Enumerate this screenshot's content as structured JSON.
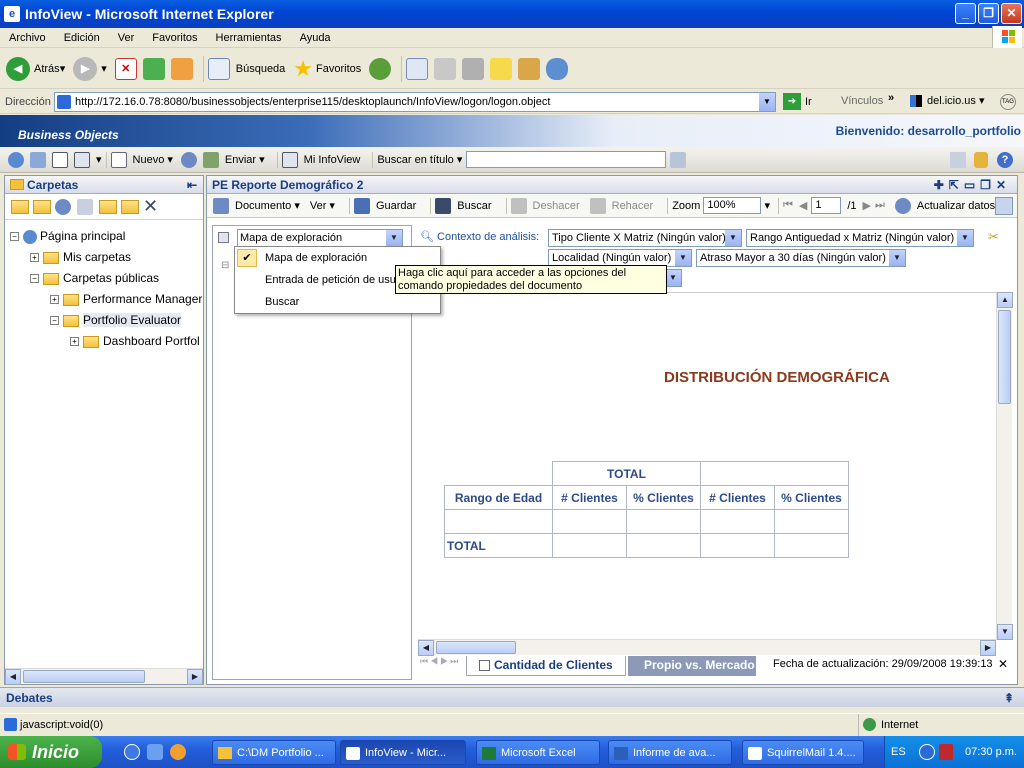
{
  "window": {
    "title": "InfoView - Microsoft Internet Explorer"
  },
  "menu": [
    "Archivo",
    "Edición",
    "Ver",
    "Favoritos",
    "Herramientas",
    "Ayuda"
  ],
  "stdtoolbar": {
    "back": "Atrás",
    "search": "Búsqueda",
    "favorites": "Favoritos"
  },
  "address": {
    "label": "Dirección",
    "url": "http://172.16.0.78:8080/businessobjects/enterprise115/desktoplaunch/InfoView/logon/logon.object",
    "go": "Ir",
    "links": "Vínculos",
    "delicious": "del.icio.us"
  },
  "bo": {
    "logo": "Business Objects",
    "welcome": "Bienvenido: desarrollo_portfolio"
  },
  "botoolbar": {
    "new": "Nuevo",
    "send": "Enviar",
    "myinfoview": "Mi InfoView",
    "search_title": "Buscar en título"
  },
  "folders": {
    "title": "Carpetas",
    "items": [
      "Página principal",
      "Mis carpetas",
      "Carpetas públicas",
      "Performance Manager",
      "Portfolio Evaluator",
      "Dashboard Portfol"
    ]
  },
  "document": {
    "title": "PE Reporte Demográfico 2",
    "document_menu": "Documento",
    "view_menu": "Ver",
    "save": "Guardar",
    "search": "Buscar",
    "undo": "Deshacer",
    "redo": "Rehacer",
    "zoom_label": "Zoom",
    "zoom": "100%",
    "page": "1",
    "pages": "/1",
    "refresh": "Actualizar datos"
  },
  "nav": {
    "selected": "Mapa de exploración",
    "options": [
      "Mapa de exploración",
      "Entrada de petición de usuario",
      "Buscar"
    ],
    "tooltip": "Haga clic aquí para acceder a las opciones del comando propiedades del documento"
  },
  "context": {
    "label": "Contexto de análisis:",
    "filters": [
      "Tipo Cliente X Matriz (Ningún valor)",
      "Rango Antiguedad x Matriz (Ningún valor)",
      "Localidad (Ningún valor)",
      "Atraso Mayor a 30 días (Ningún valor)"
    ]
  },
  "report": {
    "title": "DISTRIBUCIÓN DEMOGRÁFICA",
    "total_header": "TOTAL",
    "row_header": "Rango de Edad",
    "cols": [
      "# Clientes",
      "% Clientes",
      "# Clientes",
      "% Clientes"
    ],
    "total_row": "TOTAL"
  },
  "tabs": [
    "Cantidad de Clientes",
    "Propio vs. Mercado"
  ],
  "updated": "Fecha de actualización: 29/09/2008 19:39:13",
  "debates": "Debates",
  "status": {
    "text": "javascript:void(0)",
    "zone": "Internet"
  },
  "taskbar": {
    "start": "Inicio",
    "tasks": [
      "C:\\DM Portfolio ...",
      "InfoView - Micr...",
      "Microsoft Excel",
      "Informe de ava...",
      "SquirrelMail 1.4...."
    ],
    "lang": "ES",
    "time": "07:30 p.m."
  }
}
